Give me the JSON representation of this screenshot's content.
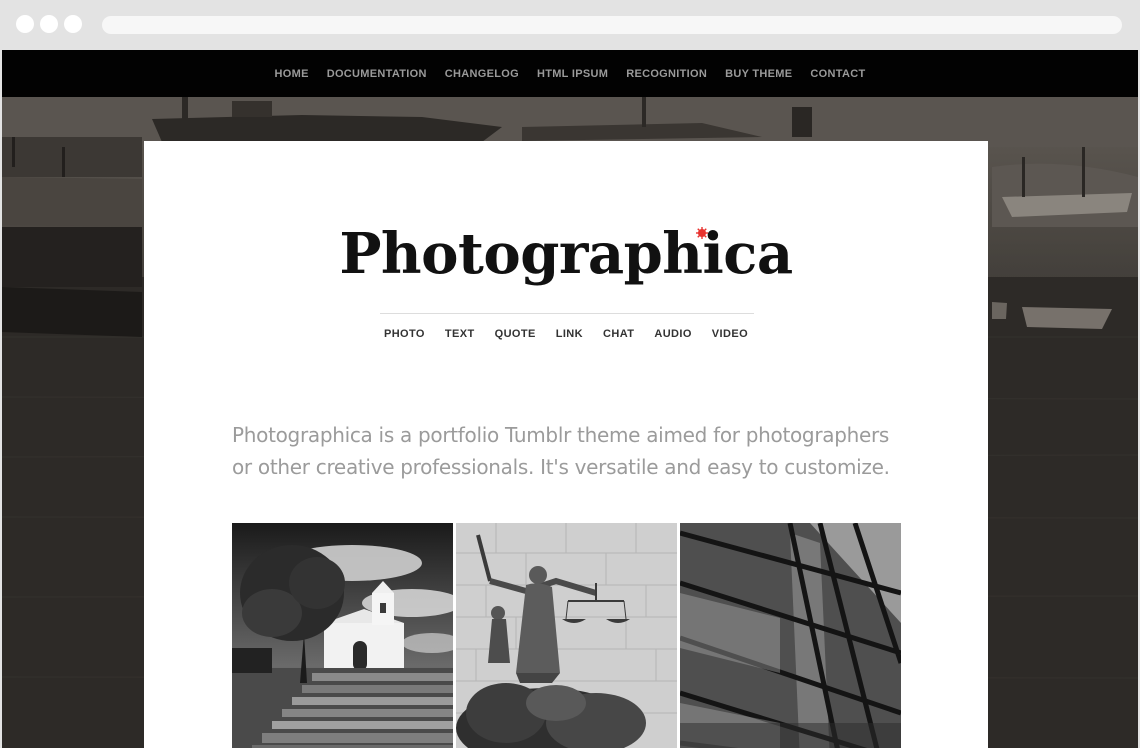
{
  "browser": {
    "title": ""
  },
  "topnav": {
    "items": [
      "HOME",
      "DOCUMENTATION",
      "CHANGELOG",
      "HTML IPSUM",
      "RECOGNITION",
      "BUY THEME",
      "CONTACT"
    ]
  },
  "site": {
    "logo": "Photographica",
    "accent_color": "#e8332f"
  },
  "postnav": {
    "items": [
      "PHOTO",
      "TEXT",
      "QUOTE",
      "LINK",
      "CHAT",
      "AUDIO",
      "VIDEO"
    ]
  },
  "intro": {
    "line1": "Photographica is a portfolio Tumblr theme aimed for photographers",
    "line2": "or other creative professionals. It's versatile and easy to customize."
  },
  "gallery": {
    "photos": [
      {
        "subject": "white chapel with tree and stone steps"
      },
      {
        "subject": "statue of justice with sword and scales"
      },
      {
        "subject": "glass building facade with chimney"
      }
    ]
  }
}
